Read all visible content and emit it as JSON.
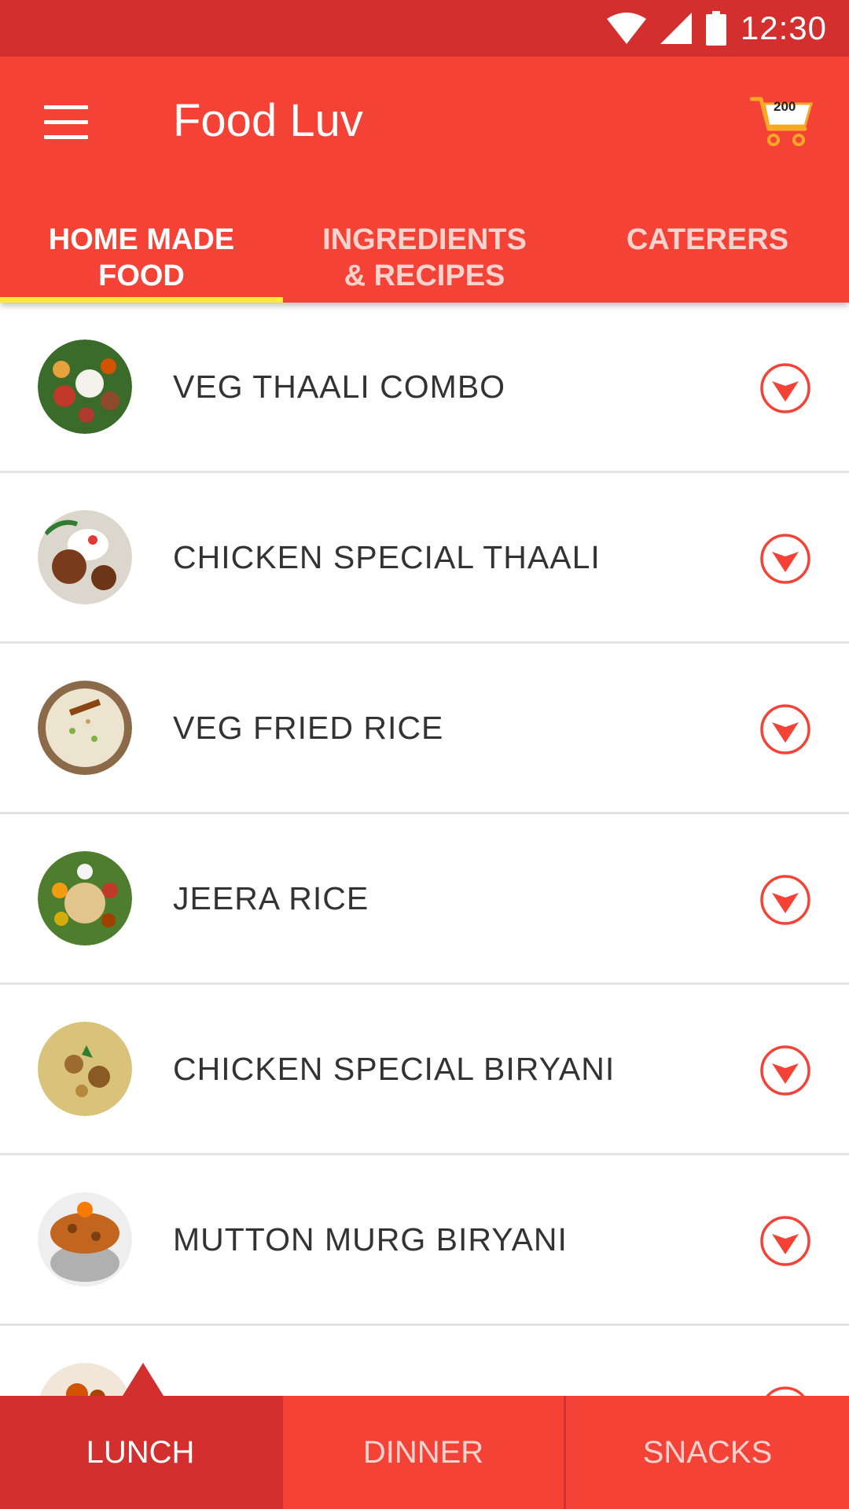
{
  "status_bar": {
    "time": "12:30"
  },
  "app_bar": {
    "title": "Food Luv",
    "cart_count": "200"
  },
  "tabs": [
    {
      "line1": "HOME MADE",
      "line2": "FOOD"
    },
    {
      "line1": "INGREDIENTS",
      "line2": "& RECIPES"
    },
    {
      "line1": "CATERERS",
      "line2": ""
    }
  ],
  "menu_items": [
    {
      "label": "VEG THAALI COMBO"
    },
    {
      "label": "CHICKEN SPECIAL THAALI"
    },
    {
      "label": "VEG FRIED RICE"
    },
    {
      "label": "JEERA RICE"
    },
    {
      "label": "CHICKEN SPECIAL BIRYANI"
    },
    {
      "label": "MUTTON MURG BIRYANI"
    }
  ],
  "bottom_tabs": [
    "LUNCH",
    "DINNER",
    "SNACKS"
  ],
  "colors": {
    "primary": "#f44336",
    "primary_dark": "#d32f2f",
    "indicator": "#ffeb3b",
    "cart_accent": "#f9a825"
  }
}
